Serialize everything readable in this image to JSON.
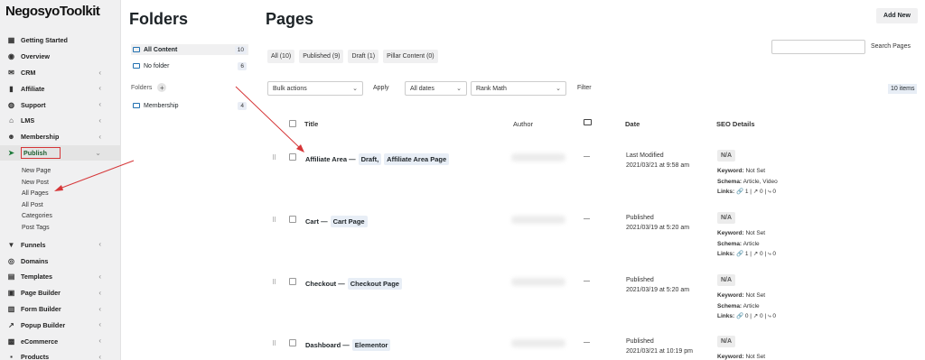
{
  "brand": {
    "name": "NegosyoToolkit"
  },
  "sidebar": {
    "items": [
      {
        "label": "Getting Started",
        "icon": "grid-icon",
        "chevron": false
      },
      {
        "label": "Overview",
        "icon": "eye-icon",
        "chevron": false
      },
      {
        "label": "CRM",
        "icon": "mail-icon",
        "chevron": true
      },
      {
        "label": "Affiliate",
        "icon": "bar-chart-icon",
        "chevron": true
      },
      {
        "label": "Support",
        "icon": "lifebuoy-icon",
        "chevron": true
      },
      {
        "label": "LMS",
        "icon": "graduation-cap-icon",
        "chevron": true
      },
      {
        "label": "Membership",
        "icon": "users-icon",
        "chevron": true
      },
      {
        "label": "Publish",
        "icon": "paper-plane-icon",
        "chevron": true,
        "active": true
      }
    ],
    "submenu": [
      "New Page",
      "New Post",
      "All Pages",
      "All Post",
      "Categories",
      "Post Tags"
    ],
    "items2": [
      {
        "label": "Funnels",
        "icon": "funnel-icon",
        "chevron": true
      },
      {
        "label": "Domains",
        "icon": "globe-icon",
        "chevron": false
      },
      {
        "label": "Templates",
        "icon": "file-icon",
        "chevron": true
      },
      {
        "label": "Page Builder",
        "icon": "layout-icon",
        "chevron": true
      },
      {
        "label": "Form Builder",
        "icon": "form-icon",
        "chevron": true
      },
      {
        "label": "Popup Builder",
        "icon": "trend-icon",
        "chevron": true
      },
      {
        "label": "eCommerce",
        "icon": "cart-icon",
        "chevron": true
      },
      {
        "label": "Products",
        "icon": "box-icon",
        "chevron": true
      }
    ]
  },
  "folders": {
    "title": "Folders",
    "all_content": {
      "label": "All Content",
      "count": "10"
    },
    "no_folder": {
      "label": "No folder",
      "count": "6"
    },
    "section_label": "Folders",
    "add_symbol": "+",
    "membership": {
      "label": "Membership",
      "count": "4"
    }
  },
  "pages": {
    "title": "Pages",
    "add_new": "Add New",
    "tabs": [
      "All (10)",
      "Published (9)",
      "Draft (1)",
      "Pillar Content (0)"
    ],
    "search_button": "Search Pages",
    "search_placeholder": "",
    "bulk_actions": "Bulk actions",
    "apply": "Apply",
    "all_dates": "All dates",
    "rank_math": "Rank Math",
    "filter": "Filter",
    "items_count": "10 items",
    "columns": {
      "title": "Title",
      "author": "Author",
      "date": "Date",
      "seo": "SEO Details"
    },
    "rows": [
      {
        "title": "Affiliate Area —",
        "tags": [
          "Draft,",
          "Affiliate Area Page"
        ],
        "author_dash": "—",
        "date_status": "Last Modified",
        "date_value": "2021/03/21 at 9:58 am",
        "seo_score": "N/A",
        "keyword_label": "Keyword:",
        "keyword": "Not Set",
        "schema_label": "Schema:",
        "schema": "Article, Video",
        "links_label": "Links:",
        "links": "🔗 1  |  ↗ 0  |  ⤷ 0"
      },
      {
        "title": "Cart —",
        "tags": [
          "Cart Page"
        ],
        "author_dash": "—",
        "date_status": "Published",
        "date_value": "2021/03/19 at 5:20 am",
        "seo_score": "N/A",
        "keyword_label": "Keyword:",
        "keyword": "Not Set",
        "schema_label": "Schema:",
        "schema": "Article",
        "links_label": "Links:",
        "links": "🔗 1  |  ↗ 0  |  ⤷ 0"
      },
      {
        "title": "Checkout —",
        "tags": [
          "Checkout Page"
        ],
        "author_dash": "—",
        "date_status": "Published",
        "date_value": "2021/03/19 at 5:20 am",
        "seo_score": "N/A",
        "keyword_label": "Keyword:",
        "keyword": "Not Set",
        "schema_label": "Schema:",
        "schema": "Article",
        "links_label": "Links:",
        "links": "🔗 0  |  ↗ 0  |  ⤷ 0"
      },
      {
        "title": "Dashboard —",
        "tags": [
          "Elementor"
        ],
        "author_dash": "—",
        "date_status": "Published",
        "date_value": "2021/03/21 at 10:19 pm",
        "seo_score": "N/A",
        "keyword_label": "Keyword:",
        "keyword": "Not Set",
        "schema_label": "",
        "schema": "",
        "links_label": "",
        "links": ""
      }
    ]
  },
  "colors": {
    "accent": "#2271b1",
    "highlight": "#d63638",
    "tag_bg": "#e8eef6"
  }
}
